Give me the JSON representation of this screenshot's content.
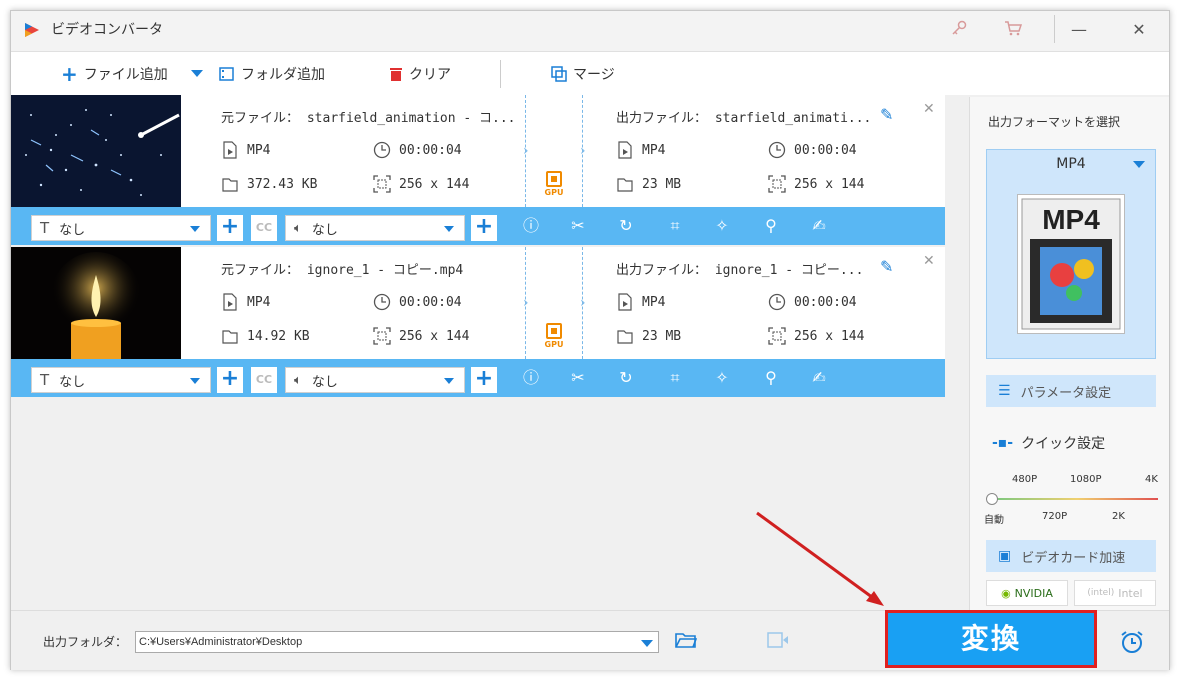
{
  "app": {
    "title": "ビデオコンバータ",
    "minimize": "—",
    "close": "✕"
  },
  "toolbar": {
    "add_file": "ファイル追加",
    "add_folder": "フォルダ追加",
    "clear": "クリア",
    "merge": "マージ"
  },
  "tasks": [
    {
      "source_label": "元ファイル：",
      "source_name": "starfield_animation - コ...",
      "src_format": "MP4",
      "src_duration": "00:00:04",
      "src_size": "372.43 KB",
      "src_resolution": "256 x 144",
      "output_label": "出力ファイル：",
      "output_name": "starfield_animati...",
      "out_format": "MP4",
      "out_duration": "00:00:04",
      "out_size": "23 MB",
      "out_resolution": "256 x 144",
      "subtitle": "なし",
      "audio": "なし",
      "gpu": "GPU",
      "thumbnail": "starfield"
    },
    {
      "source_label": "元ファイル：",
      "source_name": "ignore_1 - コピー.mp4",
      "src_format": "MP4",
      "src_duration": "00:00:04",
      "src_size": "14.92 KB",
      "src_resolution": "256 x 144",
      "output_label": "出力ファイル：",
      "output_name": "ignore_1 - コピー...",
      "out_format": "MP4",
      "out_duration": "00:00:04",
      "out_size": "23 MB",
      "out_resolution": "256 x 144",
      "subtitle": "なし",
      "audio": "なし",
      "gpu": "GPU",
      "thumbnail": "candle"
    }
  ],
  "sidebar": {
    "select_format_label": "出力フォーマットを選択",
    "format": "MP4",
    "format_image_text": "MP4",
    "param_settings": "パラメータ設定",
    "quick_settings": "クイック設定",
    "ticks_top": [
      "480P",
      "1080P",
      "4K"
    ],
    "ticks_bottom": [
      "自動",
      "720P",
      "2K"
    ],
    "gpu_accel": "ビデオカード加速",
    "vendor_nvidia": "NVIDIA",
    "vendor_intel": "Intel"
  },
  "bottom": {
    "output_folder_label": "出力フォルダ：",
    "output_path": "C:¥Users¥Administrator¥Desktop",
    "convert_label": "変換"
  },
  "colors": {
    "accent": "#19a0f3",
    "bar": "#59b7f3",
    "highlight_border": "#e02020",
    "gpu": "#f08a00"
  }
}
